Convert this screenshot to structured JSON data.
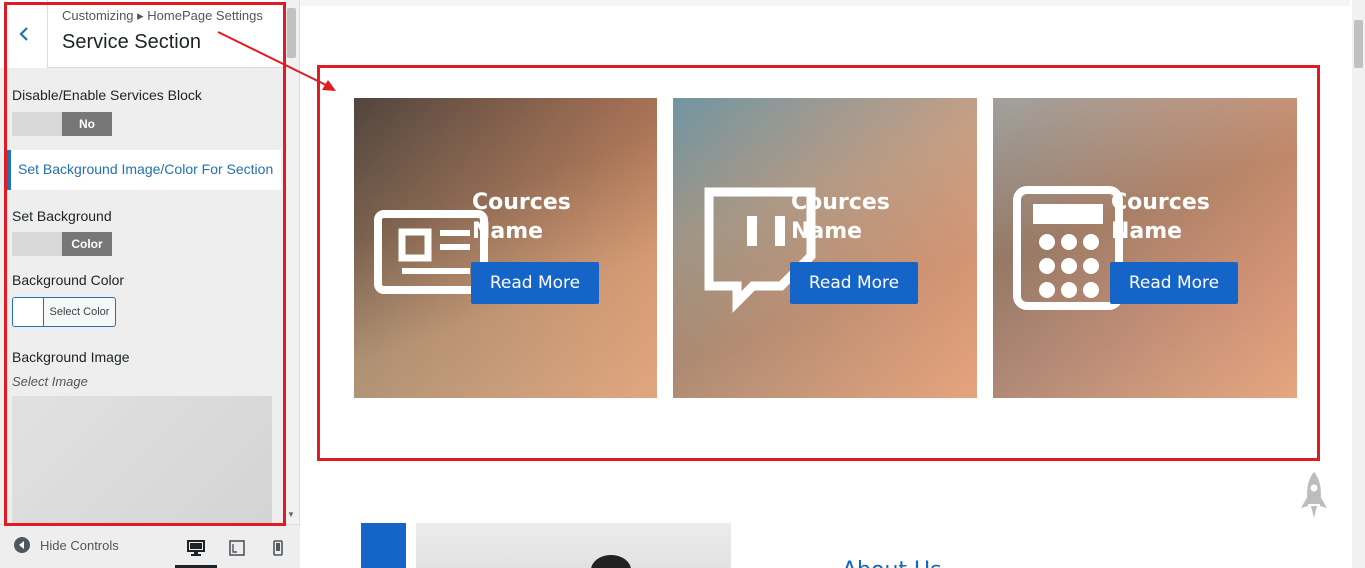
{
  "sidebar": {
    "breadcrumb": "Customizing ▸ HomePage Settings",
    "section_title": "Service Section",
    "services_block_label": "Disable/Enable Services Block",
    "services_toggle_value": "No",
    "bg_section_heading": "Set Background Image/Color For Section",
    "set_background_label": "Set Background",
    "set_background_value": "Color",
    "background_color_label": "Background Color",
    "select_color_label": "Select Color",
    "background_image_label": "Background Image",
    "select_image_label": "Select Image"
  },
  "footer": {
    "hide_controls_label": "Hide Controls"
  },
  "preview": {
    "cards": [
      {
        "name": "Cources Name",
        "button": "Read More",
        "icon": "newspaper-icon"
      },
      {
        "name": "Cources Name",
        "button": "Read More",
        "icon": "twitch-icon"
      },
      {
        "name": "Cources Name",
        "button": "Read More",
        "icon": "calculator-icon"
      }
    ],
    "about_title": "About Us"
  },
  "colors": {
    "accent": "#1565c8",
    "highlight": "#e01b24",
    "wp_blue": "#2271b1"
  }
}
